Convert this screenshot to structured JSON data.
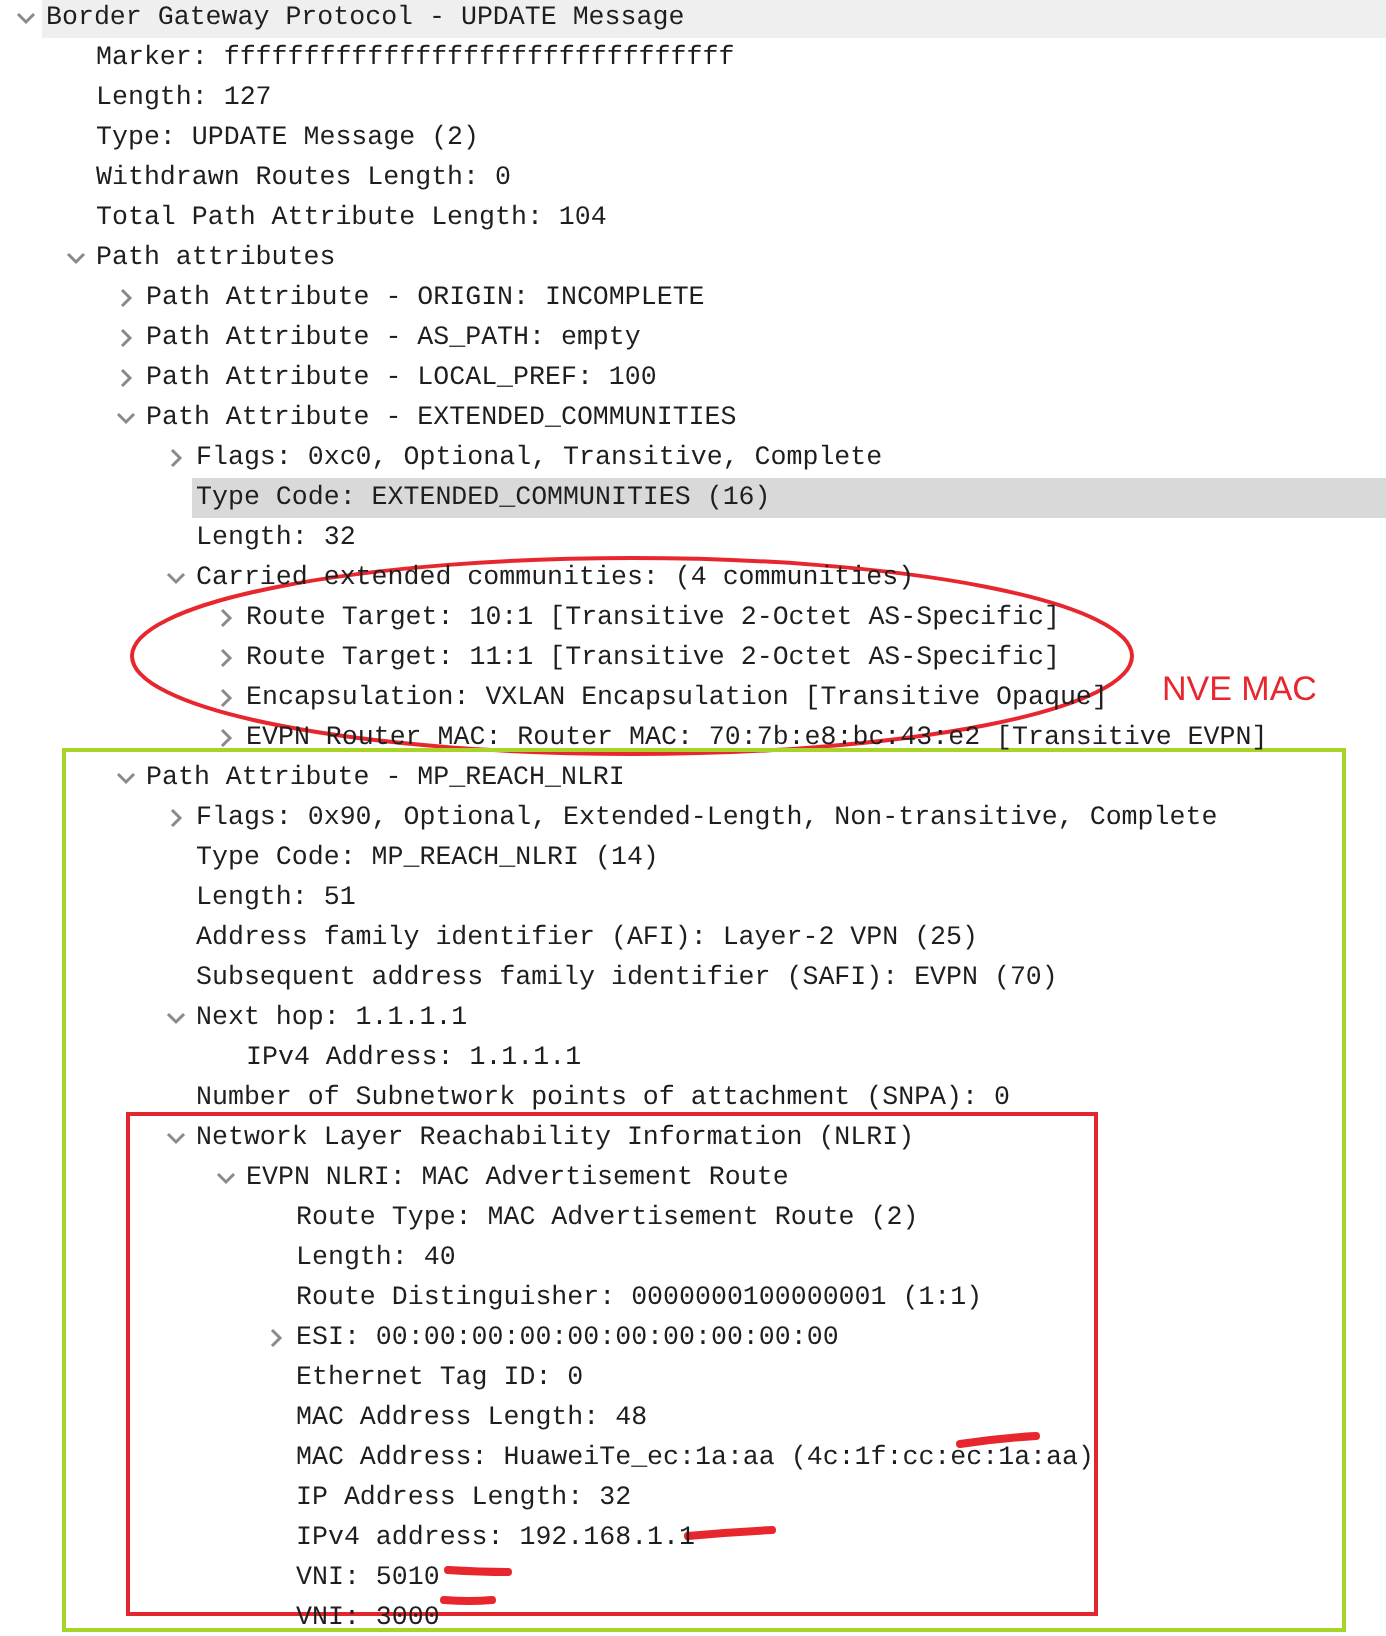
{
  "tree": [
    {
      "label": "Border Gateway Protocol - UPDATE Message",
      "expanded": true,
      "selected": false,
      "hovered": true,
      "children": [
        {
          "label": "Marker: ffffffffffffffffffffffffffffffff",
          "selected": false,
          "hovered": false
        },
        {
          "label": "Length: 127",
          "selected": false,
          "hovered": false
        },
        {
          "label": "Type: UPDATE Message (2)",
          "selected": false,
          "hovered": false
        },
        {
          "label": "Withdrawn Routes Length: 0",
          "selected": false,
          "hovered": false
        },
        {
          "label": "Total Path Attribute Length: 104",
          "selected": false,
          "hovered": false
        },
        {
          "label": "Path attributes",
          "expanded": true,
          "selected": false,
          "hovered": false,
          "children": [
            {
              "label": "Path Attribute - ORIGIN: INCOMPLETE",
              "expanded": false,
              "selected": false,
              "hovered": false
            },
            {
              "label": "Path Attribute - AS_PATH: empty",
              "expanded": false,
              "selected": false,
              "hovered": false
            },
            {
              "label": "Path Attribute - LOCAL_PREF: 100",
              "expanded": false,
              "selected": false,
              "hovered": false
            },
            {
              "label": "Path Attribute - EXTENDED_COMMUNITIES",
              "expanded": true,
              "selected": false,
              "hovered": false,
              "children": [
                {
                  "label": "Flags: 0xc0, Optional, Transitive, Complete",
                  "expanded": false,
                  "selected": false,
                  "hovered": false
                },
                {
                  "label": "Type Code: EXTENDED_COMMUNITIES (16)",
                  "selected": true,
                  "hovered": false
                },
                {
                  "label": "Length: 32",
                  "selected": false,
                  "hovered": false
                },
                {
                  "label": "Carried extended communities: (4 communities)",
                  "expanded": true,
                  "selected": false,
                  "hovered": false,
                  "children": [
                    {
                      "label": "Route Target: 10:1 [Transitive 2-Octet AS-Specific]",
                      "expanded": false,
                      "selected": false,
                      "hovered": false
                    },
                    {
                      "label": "Route Target: 11:1 [Transitive 2-Octet AS-Specific]",
                      "expanded": false,
                      "selected": false,
                      "hovered": false
                    },
                    {
                      "label": "Encapsulation: VXLAN Encapsulation [Transitive Opaque]",
                      "expanded": false,
                      "selected": false,
                      "hovered": false
                    },
                    {
                      "label": "EVPN Router MAC: Router MAC: 70:7b:e8:bc:43:e2 [Transitive EVPN]",
                      "expanded": false,
                      "selected": false,
                      "hovered": false
                    }
                  ]
                }
              ]
            },
            {
              "label": "Path Attribute - MP_REACH_NLRI",
              "expanded": true,
              "selected": false,
              "hovered": false,
              "children": [
                {
                  "label": "Flags: 0x90, Optional, Extended-Length, Non-transitive, Complete",
                  "expanded": false,
                  "selected": false,
                  "hovered": false
                },
                {
                  "label": "Type Code: MP_REACH_NLRI (14)",
                  "selected": false,
                  "hovered": false
                },
                {
                  "label": "Length: 51",
                  "selected": false,
                  "hovered": false
                },
                {
                  "label": "Address family identifier (AFI): Layer-2 VPN (25)",
                  "selected": false,
                  "hovered": false
                },
                {
                  "label": "Subsequent address family identifier (SAFI): EVPN (70)",
                  "selected": false,
                  "hovered": false
                },
                {
                  "label": "Next hop: 1.1.1.1",
                  "expanded": true,
                  "selected": false,
                  "hovered": false,
                  "children": [
                    {
                      "label": "IPv4 Address: 1.1.1.1",
                      "selected": false,
                      "hovered": false
                    }
                  ]
                },
                {
                  "label": "Number of Subnetwork points of attachment (SNPA): 0",
                  "selected": false,
                  "hovered": false
                },
                {
                  "label": "Network Layer Reachability Information (NLRI)",
                  "expanded": true,
                  "selected": false,
                  "hovered": false,
                  "children": [
                    {
                      "label": "EVPN NLRI: MAC Advertisement Route",
                      "expanded": true,
                      "selected": false,
                      "hovered": false,
                      "children": [
                        {
                          "label": "Route Type: MAC Advertisement Route (2)",
                          "selected": false,
                          "hovered": false
                        },
                        {
                          "label": "Length: 40",
                          "selected": false,
                          "hovered": false
                        },
                        {
                          "label": "Route Distinguisher: 0000000100000001 (1:1)",
                          "selected": false,
                          "hovered": false
                        },
                        {
                          "label": "ESI: 00:00:00:00:00:00:00:00:00:00",
                          "expanded": false,
                          "selected": false,
                          "hovered": false
                        },
                        {
                          "label": "Ethernet Tag ID: 0",
                          "selected": false,
                          "hovered": false
                        },
                        {
                          "label": "MAC Address Length: 48",
                          "selected": false,
                          "hovered": false
                        },
                        {
                          "label": "MAC Address: HuaweiTe_ec:1a:aa (4c:1f:cc:ec:1a:aa)",
                          "selected": false,
                          "hovered": false
                        },
                        {
                          "label": "IP Address Length: 32",
                          "selected": false,
                          "hovered": false
                        },
                        {
                          "label": "IPv4 address: 192.168.1.1",
                          "selected": false,
                          "hovered": false
                        },
                        {
                          "label": "VNI: 5010",
                          "selected": false,
                          "hovered": false
                        },
                        {
                          "label": "VNI: 3000",
                          "selected": false,
                          "hovered": false
                        }
                      ]
                    }
                  ]
                }
              ]
            }
          ]
        }
      ]
    }
  ],
  "annotations": [
    {
      "kind": "ellipse",
      "color": "#e8262e"
    },
    {
      "kind": "frame",
      "color": "#a8d42a"
    },
    {
      "kind": "frame",
      "color": "#e3262e"
    },
    {
      "kind": "label",
      "text": "NVE MAC",
      "color": "#e8262e"
    },
    {
      "kind": "scribble",
      "color": "#e8262e"
    },
    {
      "kind": "scribble",
      "color": "#e8262e"
    },
    {
      "kind": "scribble",
      "color": "#e8262e"
    },
    {
      "kind": "scribble",
      "color": "#e8262e"
    }
  ]
}
